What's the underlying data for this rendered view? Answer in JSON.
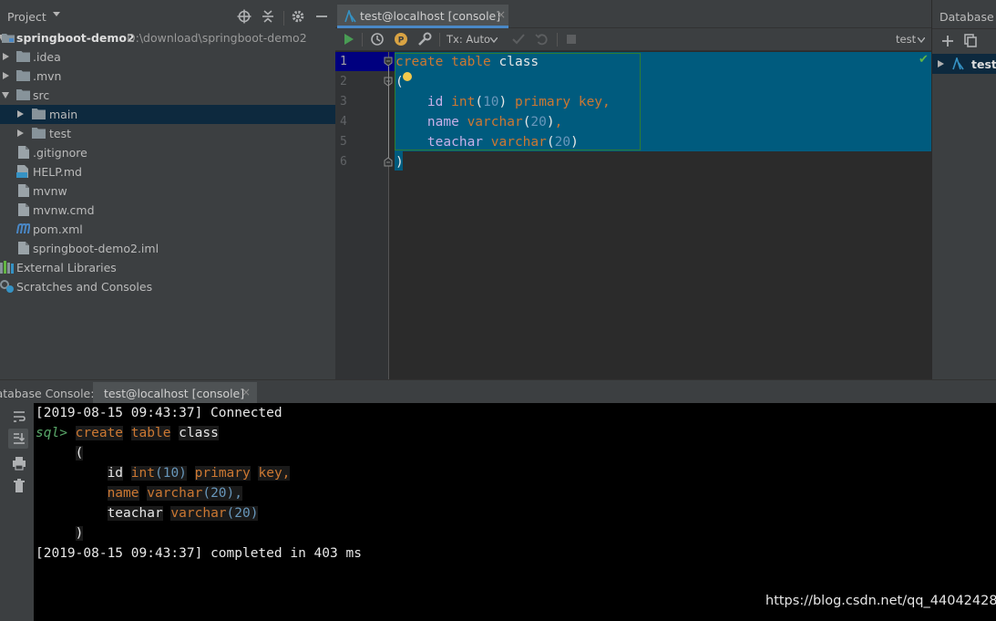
{
  "project": {
    "title": "Project",
    "tree": [
      {
        "label": "springboot-demo2",
        "path": "D:\\download\\springboot-demo2"
      },
      {
        "label": ".idea"
      },
      {
        "label": ".mvn"
      },
      {
        "label": "src"
      },
      {
        "label": "main"
      },
      {
        "label": "test"
      },
      {
        "label": ".gitignore"
      },
      {
        "label": "HELP.md"
      },
      {
        "label": "mvnw"
      },
      {
        "label": "mvnw.cmd"
      },
      {
        "label": "pom.xml"
      },
      {
        "label": "springboot-demo2.iml"
      },
      {
        "label": "External Libraries"
      },
      {
        "label": "Scratches and Consoles"
      }
    ]
  },
  "editor": {
    "tab_label": "test@localhost [console]",
    "tab_close": "×",
    "tx_label": "Tx: Auto",
    "schema_label": "test",
    "line_numbers": [
      "1",
      "2",
      "3",
      "4",
      "5",
      "6"
    ],
    "code": {
      "l1_kw1": "create",
      "l1_kw2": "table",
      "l1_name": "class",
      "l2_paren": "(",
      "l3_col": "id",
      "l3_type": "int",
      "l3_open": "(",
      "l3_num": "10",
      "l3_close": ")",
      "l3_kw1": "primary",
      "l3_kw2": "key",
      "l3_comma": ",",
      "l4_col": "name",
      "l4_type": "varchar",
      "l4_open": "(",
      "l4_num": "20",
      "l4_close": ")",
      "l4_comma": ",",
      "l5_col": "teachar",
      "l5_type": "varchar",
      "l5_open": "(",
      "l5_num": "20",
      "l5_close": ")",
      "l6_paren": ")"
    }
  },
  "database": {
    "title": "Database",
    "item": "test@"
  },
  "console": {
    "title": "Database Console:",
    "tab_label": "test@localhost [console]",
    "tab_close": "×",
    "out1": "[2019-08-15 09:43:37] Connected",
    "prompt": "sql>",
    "q1_kw1": "create",
    "q1_kw2": "table",
    "q1_name": "class",
    "q2": "(",
    "q3_col": "id",
    "q3_type": "int",
    "q3_num": "(10)",
    "q3_kw1": "primary",
    "q3_kw2": "key,",
    "q4_col": "name",
    "q4_type": "varchar",
    "q4_num": "(20),",
    "q5_col": "teachar",
    "q5_type": "varchar",
    "q5_num": "(20)",
    "q6": ")",
    "out2": "[2019-08-15 09:43:37] completed in 403 ms"
  },
  "watermark": "https://blog.csdn.net/qq_44042428",
  "colors": {
    "keyword": "#cc7832",
    "number": "#6897bb",
    "identifier": "#c7b0e8",
    "selection": "#005b7e",
    "panel": "#3c3f41",
    "editor_bg": "#2b2b2b"
  },
  "icons": {
    "run": "play-icon",
    "history": "clock-icon",
    "settings": "gear-icon",
    "wrench": "wrench-icon"
  }
}
